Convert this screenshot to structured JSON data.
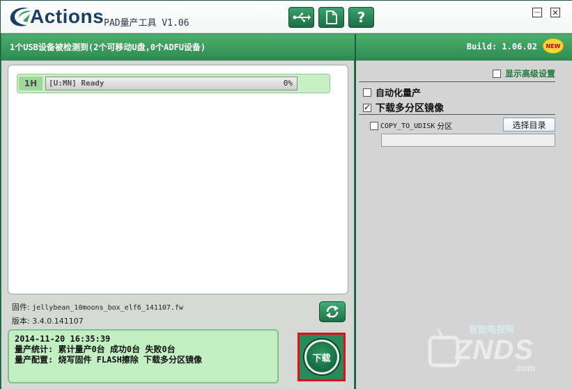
{
  "app": {
    "brand": "Actions",
    "subtitle": "PAD量产工具 V1.06"
  },
  "toolbar": {
    "buttons": [
      {
        "icon": "usb-icon"
      },
      {
        "icon": "document-icon"
      },
      {
        "label": "?",
        "icon": "help-icon"
      }
    ]
  },
  "window_controls": {
    "minimize": "—",
    "close": "✕"
  },
  "status": {
    "detected": "1个USB设备被检测到(2个可移动U盘,0个ADFU设备)",
    "build": "Build: 1.06.02",
    "new_badge": "NEW"
  },
  "devices": [
    {
      "port": "1H",
      "status": "[U:MN] Ready",
      "progress": "0%",
      "progress_value": 0
    }
  ],
  "firmware": {
    "label": "固件:",
    "file": "jellybean_10moons_box_elf6_141107.fw",
    "version_label": "版本:",
    "version": "3.4.0.141107"
  },
  "log": {
    "lines": [
      "2014-11-20 16:35:39",
      "量产统计: 累计量产0台 成功0台 失败0台",
      "量产配置: 烧写固件 FLASH擦除 下载多分区镜像"
    ]
  },
  "download_button": "下载",
  "options": {
    "advanced": {
      "label": "显示高级设置",
      "checked": false
    },
    "auto_production": {
      "label": "自动化量产",
      "checked": false
    },
    "download_multi": {
      "label": "下载多分区镜像",
      "checked": true
    },
    "copy_to_udisk": {
      "label": "COPY_TO_UDISK",
      "suffix": "分区",
      "checked": false
    },
    "select_dir": "选择目录",
    "path_value": ""
  },
  "watermark": {
    "main": "ZNDS",
    "sub": "智能电视网",
    "url": ".com"
  },
  "colors": {
    "frame_green": "#2d7e56",
    "status_green": "#3a9e5e",
    "log_bg": "#c3f0c3",
    "highlight_red": "#e0101a"
  }
}
